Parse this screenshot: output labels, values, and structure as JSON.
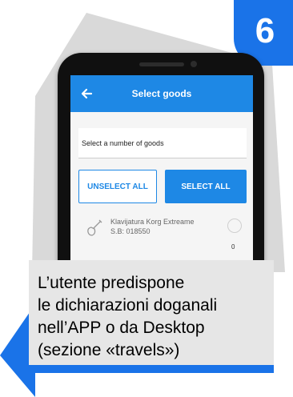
{
  "step_number": "6",
  "app": {
    "title": "Select goods",
    "search_placeholder": "Select a number of goods",
    "unselect_all_label": "UNSELECT ALL",
    "select_all_label": "SELECT ALL",
    "item": {
      "name": "Klavijatura Korg Extreame",
      "code": "S.B: 018550",
      "quantity": "0",
      "icon": "guitar-icon"
    }
  },
  "caption": {
    "lines": [
      "L’utente predispone",
      "le dichiarazioni doganali",
      "nell’APP o da Desktop",
      "(sezione «travels»)"
    ]
  },
  "colors": {
    "accent": "#1e88e5",
    "badge": "#1a73e8",
    "background_shape": "#d9d9d9",
    "caption_bg": "#e6e6e6"
  }
}
